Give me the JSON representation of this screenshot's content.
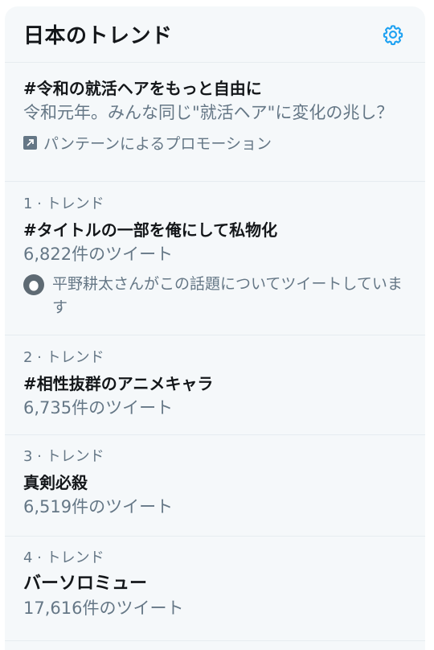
{
  "header": {
    "title": "日本のトレンド",
    "settings_icon": "gear-icon"
  },
  "promoted": {
    "name": "#令和の就活ヘアをもっと自由に",
    "description": "令和元年。みんな同じ\"就活ヘア\"に変化の兆し？",
    "promoted_by": "パンテーンによるプロモーション",
    "icon": "promoted-arrow-icon"
  },
  "trends": [
    {
      "meta": "1 · トレンド",
      "name": "#タイトルの一部を俺にして私物化",
      "count": "6,822件のツイート",
      "context": "平野耕太さんがこの話題についてツイートしています"
    },
    {
      "meta": "2 · トレンド",
      "name": "#相性抜群のアニメキャラ",
      "count": "6,735件のツイート"
    },
    {
      "meta": "3 · トレンド",
      "name": "真剣必殺",
      "count": "6,519件のツイート"
    },
    {
      "meta": "4 · トレンド",
      "name": "バーソロミュー",
      "count": "17,616件のツイート"
    }
  ],
  "colors": {
    "accent": "#1da1f2",
    "panel_bg": "#f5f8fa",
    "secondary_text": "#657786",
    "primary_text": "#14171a"
  }
}
